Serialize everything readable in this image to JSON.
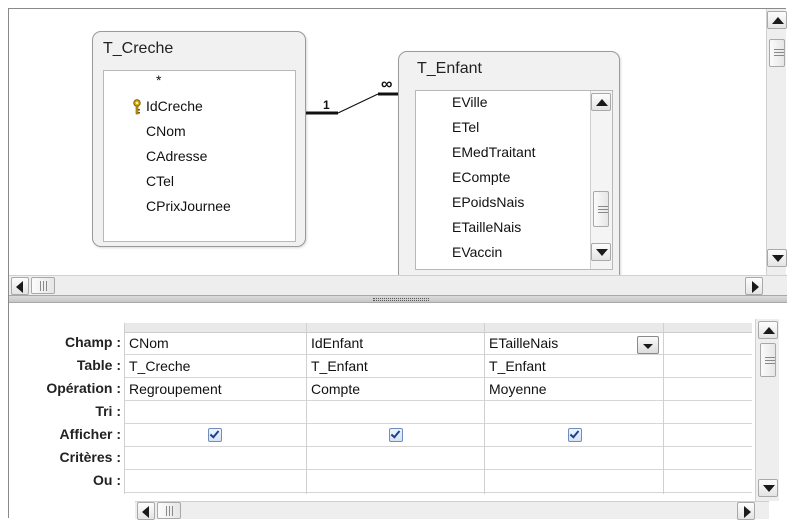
{
  "tables": [
    {
      "name": "T_Creche",
      "fields": [
        "*",
        "IdCreche",
        "CNom",
        "CAdresse",
        "CTel",
        "CPrixJournee"
      ],
      "primary_key": "IdCreche"
    },
    {
      "name": "T_Enfant",
      "fields": [
        "EVille",
        "ETel",
        "EMedTraitant",
        "ECompte",
        "EPoidsNais",
        "ETailleNais",
        "EVaccin"
      ]
    }
  ],
  "relationship": {
    "from_side": "1",
    "to_side": "∞"
  },
  "grid": {
    "row_labels": [
      "Champ :",
      "Table :",
      "Opération :",
      "Tri :",
      "Afficher :",
      "Critères :",
      "Ou :"
    ],
    "columns": [
      {
        "champ": "CNom",
        "table": "T_Creche",
        "operation": "Regroupement",
        "tri": "",
        "afficher": true,
        "criteres": "",
        "ou": ""
      },
      {
        "champ": "IdEnfant",
        "table": "T_Enfant",
        "operation": "Compte",
        "tri": "",
        "afficher": true,
        "criteres": "",
        "ou": ""
      },
      {
        "champ": "ETailleNais",
        "table": "T_Enfant",
        "operation": "Moyenne",
        "tri": "",
        "afficher": true,
        "criteres": "",
        "ou": ""
      },
      {
        "champ": "",
        "table": "",
        "operation": "",
        "tri": "",
        "afficher": false,
        "criteres": "",
        "ou": ""
      }
    ]
  },
  "icons": [
    "key-icon",
    "scroll-up-icon",
    "scroll-down-icon",
    "scroll-left-icon",
    "scroll-right-icon",
    "dropdown-arrow-icon",
    "checkmark-icon"
  ],
  "colors": {
    "checkbox_border": "#6f8dbd",
    "checkmark": "#1e3f8a",
    "window_border": "#8a8a8a"
  }
}
